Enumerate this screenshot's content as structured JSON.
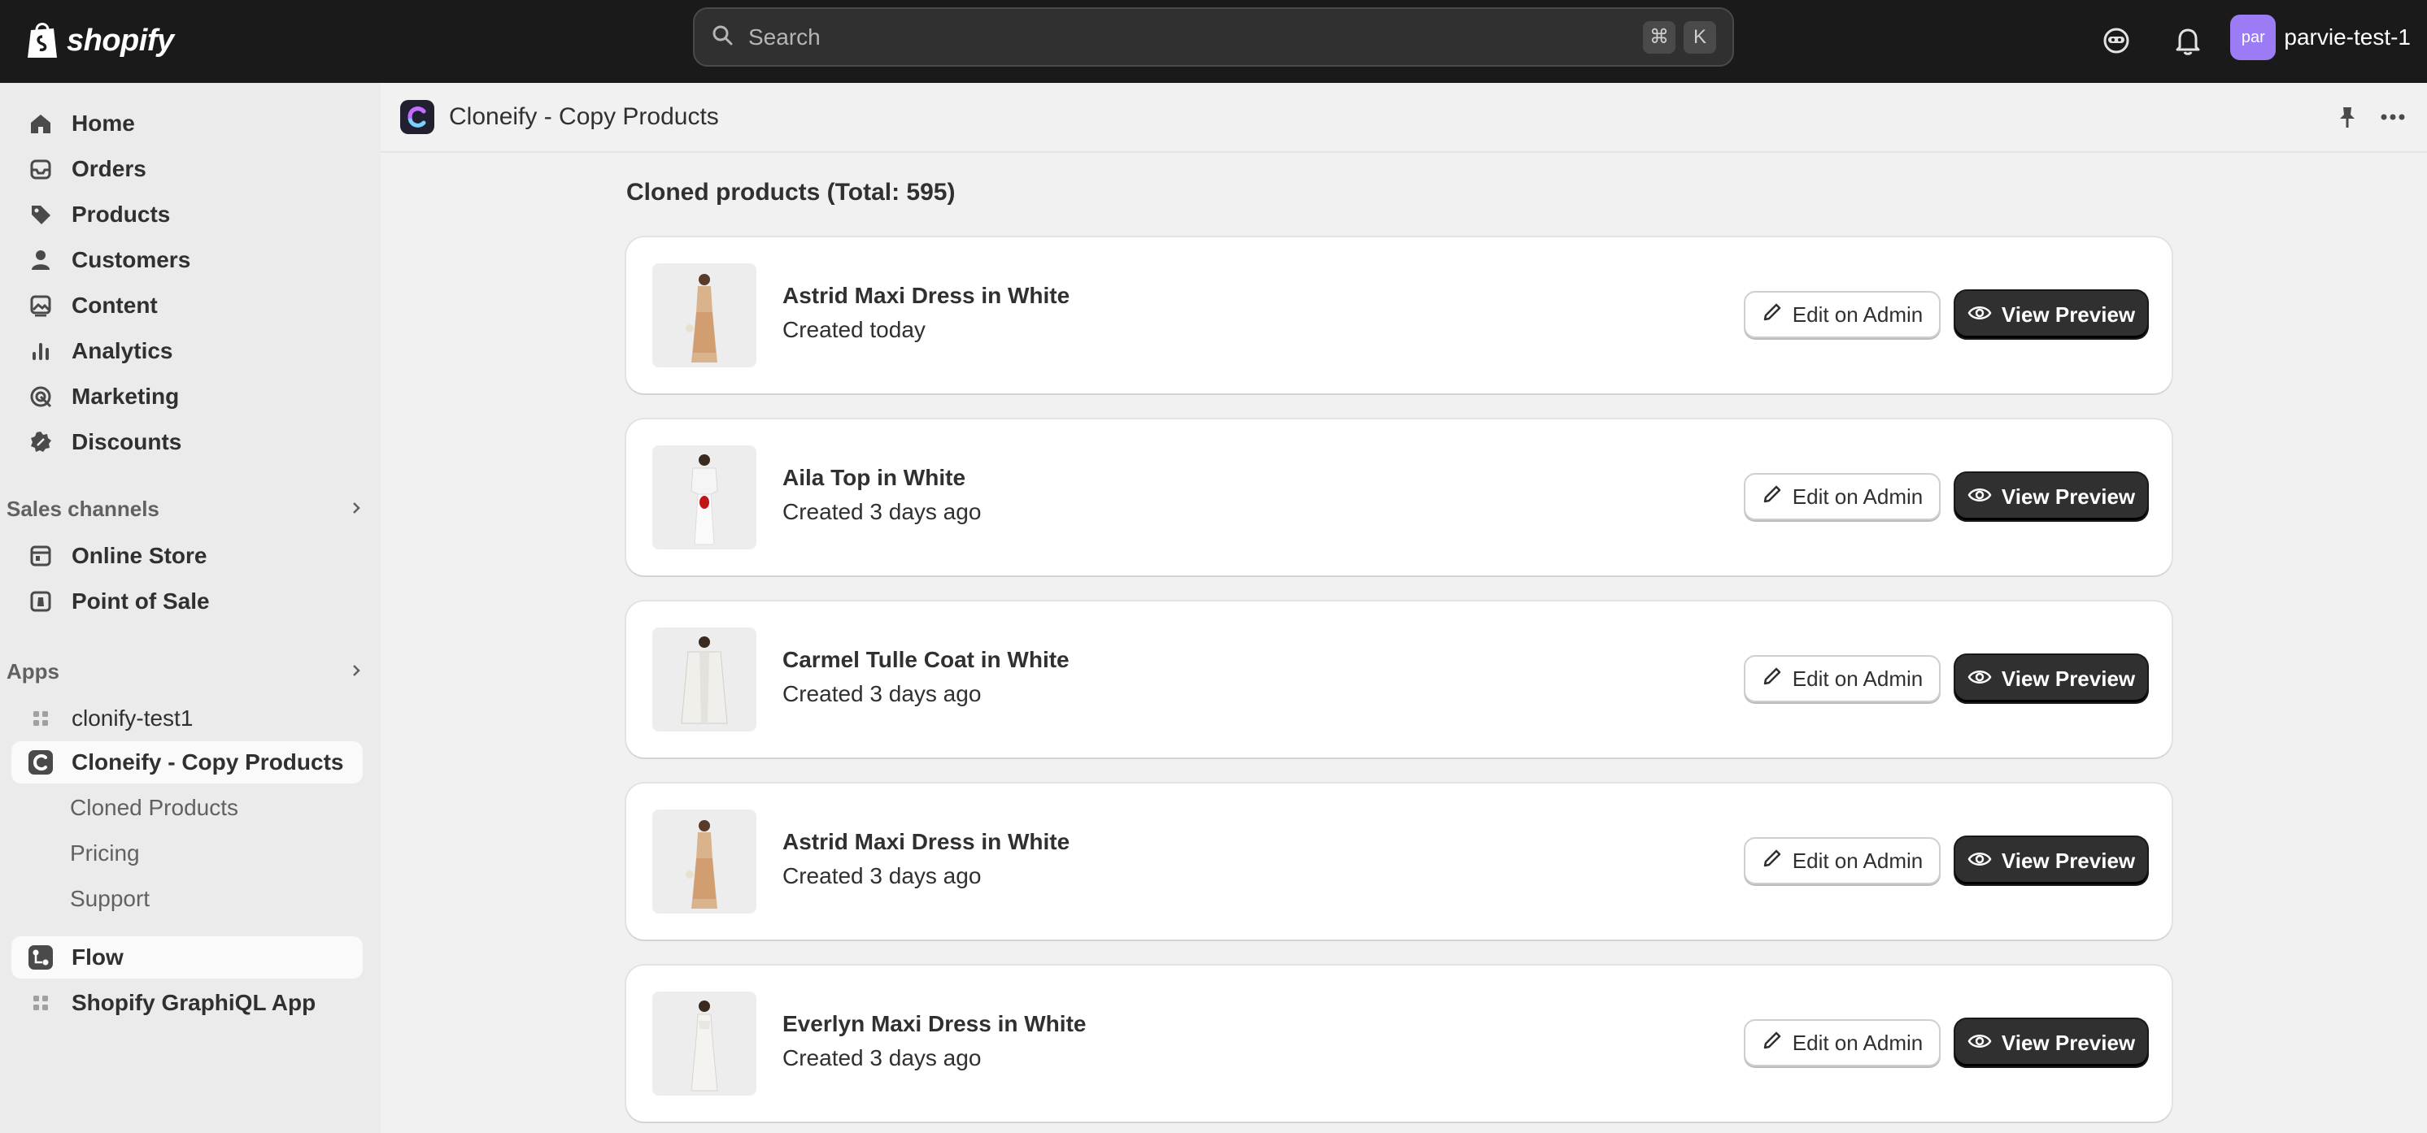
{
  "topbar": {
    "logo_text": "shopify",
    "search_placeholder": "Search",
    "shortcut_keys": [
      "⌘",
      "K"
    ],
    "avatar_initials": "par",
    "store_name": "parvie-test-1"
  },
  "sidebar": {
    "main_items": [
      {
        "label": "Home",
        "icon": "home-icon"
      },
      {
        "label": "Orders",
        "icon": "inbox-icon"
      },
      {
        "label": "Products",
        "icon": "tag-icon"
      },
      {
        "label": "Customers",
        "icon": "person-icon"
      },
      {
        "label": "Content",
        "icon": "image-icon"
      },
      {
        "label": "Analytics",
        "icon": "bar-chart-icon"
      },
      {
        "label": "Marketing",
        "icon": "target-icon"
      },
      {
        "label": "Discounts",
        "icon": "discount-icon"
      }
    ],
    "sales_channels_label": "Sales channels",
    "sales_channels": [
      {
        "label": "Online Store",
        "icon": "storefront-icon"
      },
      {
        "label": "Point of Sale",
        "icon": "pos-icon"
      }
    ],
    "apps_label": "Apps",
    "apps": [
      {
        "label": "clonify-test1",
        "icon": "app-grid-icon"
      },
      {
        "label": "Cloneify - Copy Products",
        "icon": "cloneify-icon"
      }
    ],
    "sub_items": [
      "Cloned Products",
      "Pricing",
      "Support"
    ],
    "other_apps": [
      {
        "label": "Flow",
        "icon": "flow-icon"
      },
      {
        "label": "Shopify GraphiQL App",
        "icon": "app-grid-icon"
      }
    ]
  },
  "app_header": {
    "title": "Cloneify - Copy Products"
  },
  "content": {
    "title": "Cloned products (Total: 595)",
    "edit_label": "Edit on Admin",
    "view_label": "View Preview",
    "products": [
      {
        "name": "Astrid Maxi Dress in White",
        "created": "Created today"
      },
      {
        "name": "Aila Top in White",
        "created": "Created 3 days ago"
      },
      {
        "name": "Carmel Tulle Coat in White",
        "created": "Created 3 days ago"
      },
      {
        "name": "Astrid Maxi Dress in White",
        "created": "Created 3 days ago"
      },
      {
        "name": "Everlyn Maxi Dress in White",
        "created": "Created 3 days ago"
      }
    ]
  },
  "colors": {
    "topbar_bg": "#1a1a1a",
    "sidebar_bg": "#ebebeb",
    "primary_button": "#303030",
    "avatar": "#9b7cf5"
  }
}
